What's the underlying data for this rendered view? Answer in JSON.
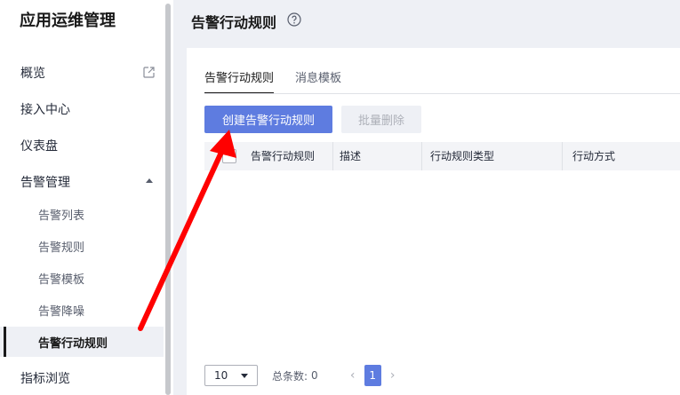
{
  "sidebar": {
    "title": "应用运维管理",
    "items": [
      {
        "label": "概览"
      },
      {
        "label": "接入中心"
      },
      {
        "label": "仪表盘"
      },
      {
        "label": "告警管理"
      },
      {
        "label": "告警列表"
      },
      {
        "label": "告警规则"
      },
      {
        "label": "告警模板"
      },
      {
        "label": "告警降噪"
      },
      {
        "label": "告警行动规则"
      },
      {
        "label": "指标浏览"
      }
    ]
  },
  "header": {
    "title": "告警行动规则"
  },
  "tabs": [
    {
      "label": "告警行动规则",
      "active": true
    },
    {
      "label": "消息模板",
      "active": false
    }
  ],
  "toolbar": {
    "create_label": "创建告警行动规则",
    "batch_delete_label": "批量删除"
  },
  "table": {
    "columns": [
      "告警行动规则",
      "描述",
      "行动规则类型",
      "行动方式"
    ]
  },
  "pagination": {
    "page_size": "10",
    "total_label": "总条数:",
    "total_value": "0",
    "current_page": "1"
  },
  "colors": {
    "primary": "#5e7ce0",
    "annotation_arrow": "#ff0000"
  }
}
